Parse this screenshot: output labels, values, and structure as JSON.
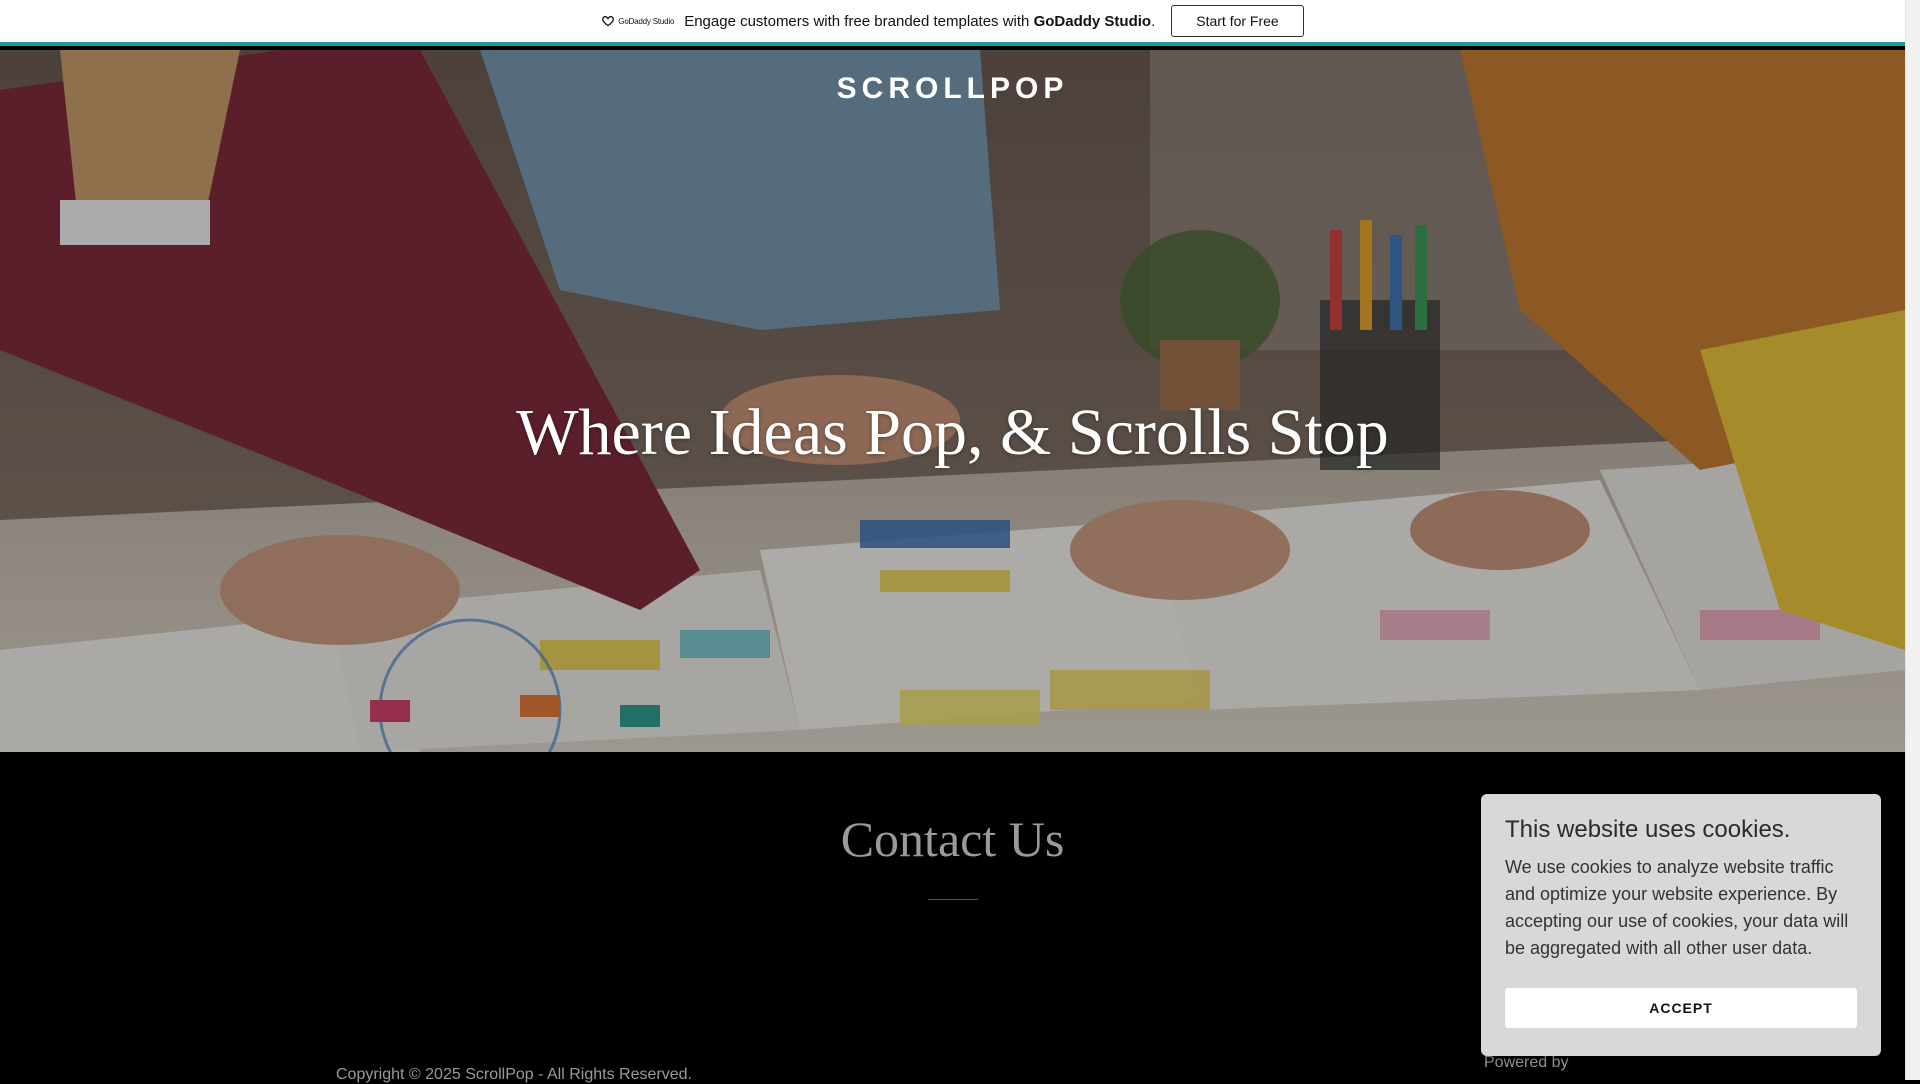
{
  "promo": {
    "logo_text": "GoDaddy Studio",
    "message": "Engage customers with free branded templates with",
    "brand": "GoDaddy Studio",
    "period": ".",
    "button_label": "Start for Free",
    "accent_color": "#1d9aa0"
  },
  "header": {
    "site_title": "SCROLLPOP"
  },
  "hero": {
    "headline": "Where Ideas Pop, & Scrolls Stop"
  },
  "contact": {
    "heading": "Contact Us"
  },
  "footer": {
    "copyright": "Copyright © 2025 ScrollPop - All Rights Reserved.",
    "powered_by": "Powered by"
  },
  "cookie_banner": {
    "title": "This website uses cookies.",
    "body": "We use cookies to analyze website traffic and optimize your website experience. By accepting our use of cookies, your data will be aggregated with all other user data.",
    "accept_label": "ACCEPT"
  }
}
